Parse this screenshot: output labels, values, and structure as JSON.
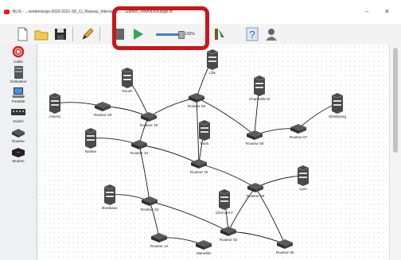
{
  "window": {
    "title": "BLIS - ...ventenningo-2020-2021-S9_Ci_Reseau_Interval C... ...Games_RWAN/Routage lit",
    "minimize": "–",
    "close": "✕"
  },
  "toolbar": {
    "speed_label": "100%"
  },
  "palette": {
    "items": [
      {
        "label": "Cable"
      },
      {
        "label": "Ordinateur"
      },
      {
        "label": "Portable"
      },
      {
        "label": "Switch"
      },
      {
        "label": "Routeur"
      },
      {
        "label": "Modem"
      }
    ]
  },
  "network": {
    "nodes": [
      {
        "label": "Amiens",
        "kind": "server"
      },
      {
        "label": "Routeur 28",
        "kind": "router"
      },
      {
        "label": "Rouen",
        "kind": "server"
      },
      {
        "label": "Routeur 29",
        "kind": "router"
      },
      {
        "label": "Lille",
        "kind": "server"
      },
      {
        "label": "Routeur 59",
        "kind": "router"
      },
      {
        "label": "Charleville M",
        "kind": "server"
      },
      {
        "label": "Routeur 08",
        "kind": "router"
      },
      {
        "label": "Strasbourg",
        "kind": "server"
      },
      {
        "label": "Routeur 67",
        "kind": "router"
      },
      {
        "label": "Nantes",
        "kind": "server"
      },
      {
        "label": "Routeur 44",
        "kind": "router"
      },
      {
        "label": "Paris",
        "kind": "server"
      },
      {
        "label": "Routeur 75",
        "kind": "router"
      },
      {
        "label": "Lyon",
        "kind": "server"
      },
      {
        "label": "Routeur 69",
        "kind": "router"
      },
      {
        "label": "Bordeaux",
        "kind": "server"
      },
      {
        "label": "Routeur 33",
        "kind": "router"
      },
      {
        "label": "Clermont F",
        "kind": "server"
      },
      {
        "label": "Routeur 63",
        "kind": "router"
      },
      {
        "label": "Routeur 12",
        "kind": "router"
      },
      {
        "label": "Marseille",
        "kind": "router"
      },
      {
        "label": "Routeur 06",
        "kind": "router"
      }
    ]
  }
}
